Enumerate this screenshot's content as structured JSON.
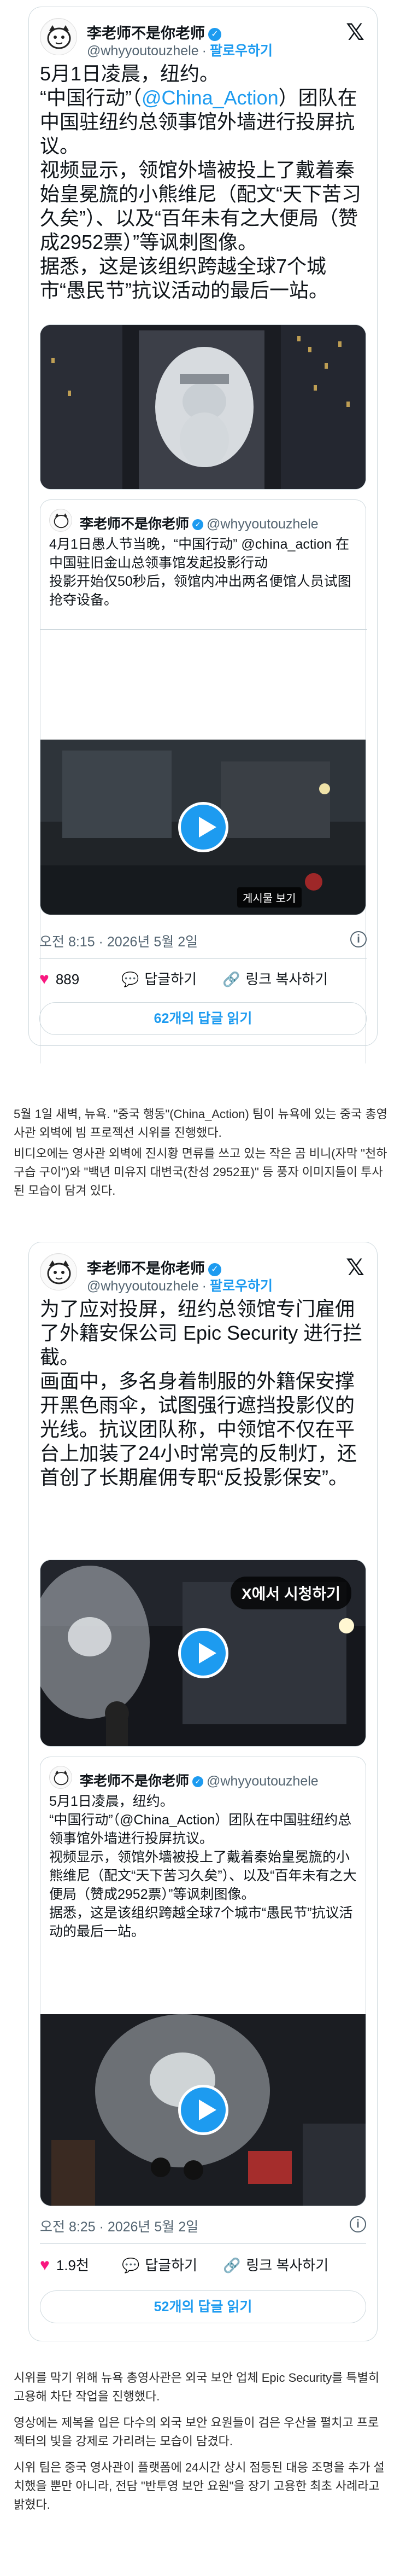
{
  "post1": {
    "author_name": "李老师不是你老师",
    "handle": "@whyyoutouzhele",
    "follow_label": "팔로우하기",
    "body_lines": [
      "5月1日凌晨，纽约。",
      "“中国行动”（",
      "@China_Action",
      "）团队在中国驻纽约总领事馆外墙进行投屏抗议。",
      "视频显示，领馆外墙被投上了戴着秦始皇冕旒的小熊维尼（配文“天下苦习久矣”）、以及“百年未有之大便局（赞成2952票）”等讽刺图像。",
      "据悉，这是该组织跨越全球7个城市“愚民节”抗议活动的最后一站。"
    ],
    "quote": {
      "author_name": "李老师不是你老师",
      "handle": "@whyyoutouzhele",
      "text": "4月1日愚人节当晚，“中国行动” @china_action 在中国驻旧金山总领事馆发起投影行动\n投影开始仅50秒后，领馆内冲出两名便馆人员试图抢夺设备。",
      "tooltip": "게시물 보기"
    },
    "timestamp": "오전 8:15 · 2026년 5월 2일",
    "likes": "889",
    "reply_label": "답글하기",
    "copy_link_label": "링크 복사하기",
    "read_replies_label": "62개의 답글 읽기"
  },
  "caption1": "5월 1일 새벽, 뉴욕. \"중국 행동\"(China_Action) 팀이 뉴욕에 있는 중국 총영사관 외벽에 빔 프로젝션 시위를 진행했다.",
  "caption1b": "비디오에는 영사관 외벽에 진시황 면류를 쓰고 있는 작은 곰 비니(자막 \"천하 구습 구이\")와 \"백년 미유지 대변국(찬성 2952표)\" 등 풍자 이미지들이 투사된 모습이 담겨 있다.",
  "post2": {
    "author_name": "李老师不是你老师",
    "handle": "@whyyoutouzhele",
    "follow_label": "팔로우하기",
    "body": "为了应对投屏，纽约总领馆专门雇佣了外籍安保公司 Epic Security 进行拦截。\n画面中，多名身着制服的外籍保安撑开黑色雨伞，试图强行遮挡投影仪的光线。抗议团队称，中领馆不仅在平台上加装了24小时常亮的反制灯，还首创了长期雇佣专职“反投影保安”。",
    "watch_label": "X에서 시청하기",
    "quote": {
      "author_name": "李老师不是你老师",
      "handle": "@whyyoutouzhele",
      "text": "5月1日凌晨，纽约。\n“中国行动”（@China_Action）团队在中国驻纽约总领事馆外墙进行投屏抗议。\n视频显示，领馆外墙被投上了戴着秦始皇冕旒的小熊维尼（配文“天下苦习久矣”）、以及“百年未有之大便局（赞成2952票）”等讽刺图像。\n据悉，这是该组织跨越全球7个城市“愚民节”抗议活动的最后一站。"
    },
    "timestamp": "오전 8:25 · 2026년 5월 2일",
    "likes": "1.9천",
    "reply_label": "답글하기",
    "copy_link_label": "링크 복사하기",
    "read_replies_label": "52개의 답글 읽기"
  },
  "caption2": "시위를 막기 위해 뉴욕 총영사관은 외국 보안 업체 Epic Security를 특별히 고용해 차단 작업을 진행했다.",
  "caption3": "영상에는 제복을 입은 다수의 외국 보안 요원들이 검은 우산을 펼치고 프로젝터의 빛을 강제로 가리려는 모습이 담겼다.",
  "caption4": "시위 팀은 중국 영사관이 플랫폼에 24시간 상시 점등된 대응 조명을 추가 설치했을 뿐만 아니라, 전담 \"반투영 보안 요원\"을 장기 고용한 최초 사례라고 밝혔다.",
  "colors": {
    "accent": "#1d9bf0",
    "like": "#f91880",
    "border": "#cfd9de",
    "muted": "#536471"
  }
}
